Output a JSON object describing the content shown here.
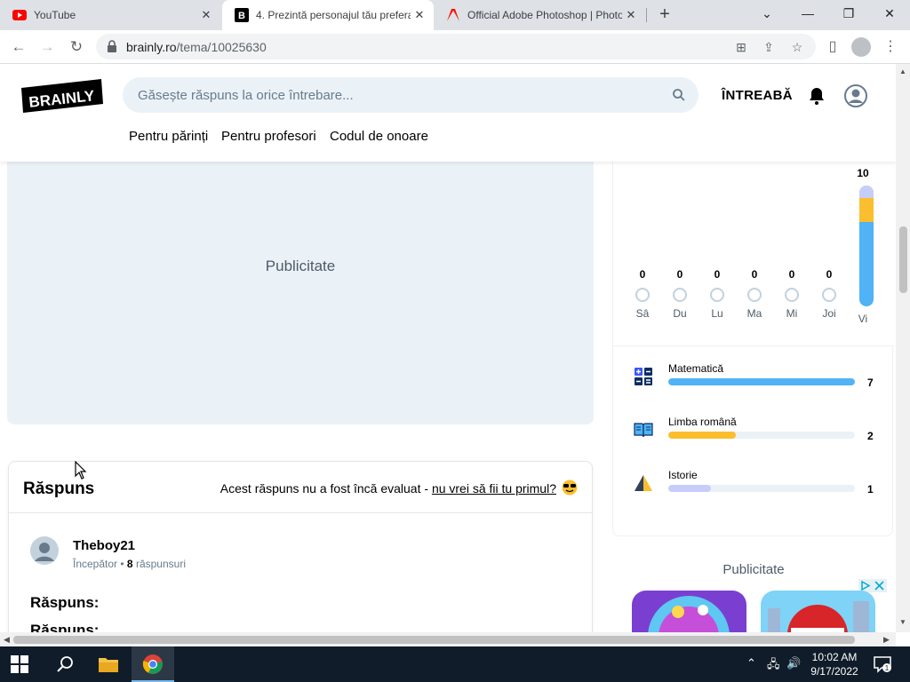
{
  "browser": {
    "tabs": [
      {
        "title": "YouTube",
        "active": false
      },
      {
        "title": "4. Prezintă personajul tău prefera",
        "active": true
      },
      {
        "title": "Official Adobe Photoshop | Photo",
        "active": false
      }
    ],
    "new_tab": "+",
    "url_host": "brainly.ro",
    "url_path": "/tema/10025630"
  },
  "site": {
    "logo_text": "BRAINLY",
    "search_placeholder": "Găsește răspuns la orice întrebare...",
    "ask_label": "ÎNTREABĂ",
    "subnav": [
      "Pentru părinți",
      "Pentru profesori",
      "Codul de onoare"
    ]
  },
  "main": {
    "ad_label": "Publicitate",
    "answer": {
      "title": "Răspuns",
      "note_text": "Acest răspuns nu a fost încă evaluat - ",
      "note_link": "nu vrei să fii tu primul?",
      "username": "Theboy21",
      "rank": "Începător",
      "answers_count": "8",
      "answers_label": "răspunsuri",
      "body_line1": "Răspuns:",
      "body_line2": "Răspuns:"
    }
  },
  "sidebar": {
    "week": [
      {
        "day": "Sâ",
        "count": "0"
      },
      {
        "day": "Du",
        "count": "0"
      },
      {
        "day": "Lu",
        "count": "0"
      },
      {
        "day": "Ma",
        "count": "0"
      },
      {
        "day": "Mi",
        "count": "0"
      },
      {
        "day": "Joi",
        "count": "0"
      }
    ],
    "today": {
      "day": "Vi",
      "count": "10"
    },
    "subjects": [
      {
        "name": "Matematică",
        "count": "7",
        "progress": 1.0,
        "color": "#4fb3f6"
      },
      {
        "name": "Limba română",
        "count": "2",
        "progress": 0.36,
        "color": "#fbbe2e"
      },
      {
        "name": "Istorie",
        "count": "1",
        "progress": 0.23,
        "color": "#c6cdf8"
      }
    ],
    "ad_label": "Publicitate"
  },
  "taskbar": {
    "time": "10:02 AM",
    "date": "9/17/2022",
    "notifications": "1"
  },
  "colors": {
    "brand_dark": "#000000",
    "search_bg": "#ebf2f7",
    "taskbar_bg": "#101c29"
  }
}
